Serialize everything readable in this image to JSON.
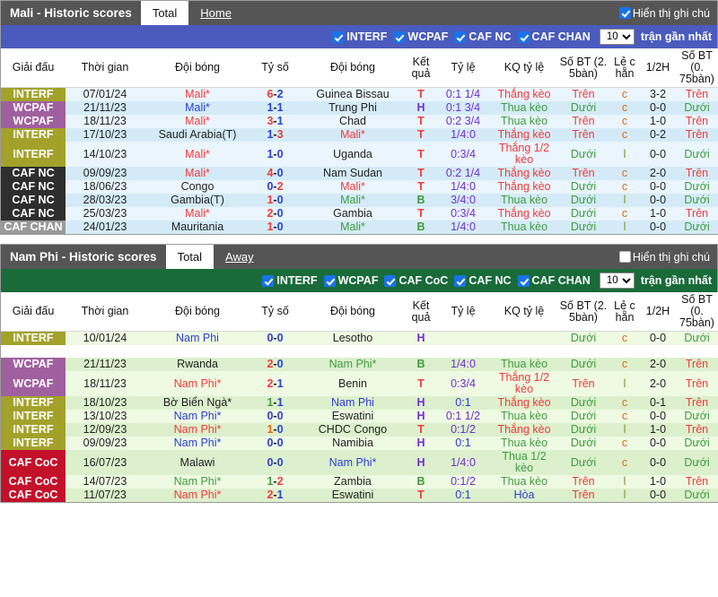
{
  "panels": [
    {
      "title": "Mali - Historic scores",
      "tabs": [
        {
          "label": "Total",
          "active": true
        },
        {
          "label": "Home",
          "active": false
        }
      ],
      "note_toggle": {
        "label": "Hiển thị ghi chú",
        "checked": true
      },
      "filter": {
        "options": [
          {
            "label": "INTERF",
            "checked": true
          },
          {
            "label": "WCPAF",
            "checked": true
          },
          {
            "label": "CAF NC",
            "checked": true
          },
          {
            "label": "CAF CHAN",
            "checked": true
          }
        ],
        "count_value": "10",
        "count_options": [
          "10",
          "20",
          "30",
          "50"
        ],
        "count_label": "trận gần nhất",
        "bar_color": "#4a5bbd"
      },
      "columns": [
        "Giải đấu",
        "Thời gian",
        "Đội bóng",
        "Tỷ số",
        "Đội bóng",
        "Kết quả",
        "Tỷ lệ",
        "KQ tỷ lệ",
        "Số BT (2. 5bàn)",
        "Lẻ c hẵn",
        "1/2H",
        "Số BT (0. 75bàn)"
      ],
      "league_colors": {
        "INTERF": "#a2a22a",
        "WCPAF": "#a0609f",
        "CAF NC": "#2e2e2e",
        "CAF CHAN": "#9a9a9a",
        "CAF CoC": "#c4112a"
      },
      "rows": [
        {
          "league": "INTERF",
          "date": "07/01/24",
          "home": "Mali*",
          "home_color": "c-red",
          "score": "6-2",
          "score_a_color": "c-red",
          "score_b_color": "c-blue",
          "away": "Guinea Bissau",
          "away_color": "c-dark",
          "result": "T",
          "result_color": "c-red",
          "odds": "0:1 1/4",
          "odds_color": "c-purple",
          "odds_result": "Thắng kèo",
          "odds_result_color": "c-red",
          "ou25": "Trên",
          "ou25_color": "c-red",
          "oddeven": "c",
          "oddeven_color": "c-orange",
          "ht": "3-2",
          "ht_color": "c-dark",
          "ou075": "Trên",
          "ou075_color": "c-red"
        },
        {
          "league": "WCPAF",
          "date": "21/11/23",
          "home": "Mali*",
          "home_color": "c-blue",
          "score": "1-1",
          "score_a_color": "c-blue",
          "score_b_color": "c-blue",
          "away": "Trung Phi",
          "away_color": "c-dark",
          "result": "H",
          "result_color": "c-purple",
          "odds": "0:1 3/4",
          "odds_color": "c-purple",
          "odds_result": "Thua kèo",
          "odds_result_color": "c-green",
          "ou25": "Dưới",
          "ou25_color": "c-green",
          "oddeven": "c",
          "oddeven_color": "c-orange",
          "ht": "0-0",
          "ht_color": "c-dark",
          "ou075": "Dưới",
          "ou075_color": "c-green"
        },
        {
          "league": "WCPAF",
          "date": "18/11/23",
          "home": "Mali*",
          "home_color": "c-red",
          "score": "3-1",
          "score_a_color": "c-red",
          "score_b_color": "c-blue",
          "away": "Chad",
          "away_color": "c-dark",
          "result": "T",
          "result_color": "c-red",
          "odds": "0:2 3/4",
          "odds_color": "c-purple",
          "odds_result": "Thua kèo",
          "odds_result_color": "c-green",
          "ou25": "Trên",
          "ou25_color": "c-red",
          "oddeven": "c",
          "oddeven_color": "c-orange",
          "ht": "1-0",
          "ht_color": "c-dark",
          "ou075": "Trên",
          "ou075_color": "c-red"
        },
        {
          "league": "INTERF",
          "date": "17/10/23",
          "home": "Saudi Arabia(T)",
          "home_color": "c-dark",
          "score": "1-3",
          "score_a_color": "c-blue",
          "score_b_color": "c-red",
          "away": "Mali*",
          "away_color": "c-red",
          "result": "T",
          "result_color": "c-red",
          "odds": "1/4:0",
          "odds_color": "c-purple",
          "odds_result": "Thắng kèo",
          "odds_result_color": "c-red",
          "ou25": "Trên",
          "ou25_color": "c-red",
          "oddeven": "c",
          "oddeven_color": "c-orange",
          "ht": "0-2",
          "ht_color": "c-dark",
          "ou075": "Trên",
          "ou075_color": "c-red"
        },
        {
          "league": "INTERF",
          "date": "14/10/23",
          "home": "Mali*",
          "home_color": "c-red",
          "score": "1-0",
          "score_a_color": "c-blue",
          "score_b_color": "c-blue",
          "away": "Uganda",
          "away_color": "c-dark",
          "result": "T",
          "result_color": "c-red",
          "odds": "0:3/4",
          "odds_color": "c-purple",
          "odds_result": "Thắng 1/2 kèo",
          "odds_result_color": "c-red",
          "ou25": "Dưới",
          "ou25_color": "c-green",
          "oddeven": "l",
          "oddeven_color": "c-olive",
          "ht": "0-0",
          "ht_color": "c-dark",
          "ou075": "Dưới",
          "ou075_color": "c-green"
        },
        {
          "league": "CAF NC",
          "date": "09/09/23",
          "home": "Mali*",
          "home_color": "c-red",
          "score": "4-0",
          "score_a_color": "c-red",
          "score_b_color": "c-blue",
          "away": "Nam Sudan",
          "away_color": "c-dark",
          "result": "T",
          "result_color": "c-red",
          "odds": "0:2 1/4",
          "odds_color": "c-purple",
          "odds_result": "Thắng kèo",
          "odds_result_color": "c-red",
          "ou25": "Trên",
          "ou25_color": "c-red",
          "oddeven": "c",
          "oddeven_color": "c-orange",
          "ht": "2-0",
          "ht_color": "c-dark",
          "ou075": "Trên",
          "ou075_color": "c-red"
        },
        {
          "league": "CAF NC",
          "date": "18/06/23",
          "home": "Congo",
          "home_color": "c-dark",
          "score": "0-2",
          "score_a_color": "c-blue",
          "score_b_color": "c-red",
          "away": "Mali*",
          "away_color": "c-red",
          "result": "T",
          "result_color": "c-red",
          "odds": "1/4:0",
          "odds_color": "c-purple",
          "odds_result": "Thắng kèo",
          "odds_result_color": "c-red",
          "ou25": "Dưới",
          "ou25_color": "c-green",
          "oddeven": "c",
          "oddeven_color": "c-orange",
          "ht": "0-0",
          "ht_color": "c-dark",
          "ou075": "Dưới",
          "ou075_color": "c-green"
        },
        {
          "league": "CAF NC",
          "date": "28/03/23",
          "home": "Gambia(T)",
          "home_color": "c-dark",
          "score": "1-0",
          "score_a_color": "c-red",
          "score_b_color": "c-blue",
          "away": "Mali*",
          "away_color": "c-green",
          "result": "B",
          "result_color": "c-green",
          "odds": "3/4:0",
          "odds_color": "c-purple",
          "odds_result": "Thua kèo",
          "odds_result_color": "c-green",
          "ou25": "Dưới",
          "ou25_color": "c-green",
          "oddeven": "l",
          "oddeven_color": "c-olive",
          "ht": "0-0",
          "ht_color": "c-dark",
          "ou075": "Dưới",
          "ou075_color": "c-green"
        },
        {
          "league": "CAF NC",
          "date": "25/03/23",
          "home": "Mali*",
          "home_color": "c-red",
          "score": "2-0",
          "score_a_color": "c-red",
          "score_b_color": "c-blue",
          "away": "Gambia",
          "away_color": "c-dark",
          "result": "T",
          "result_color": "c-red",
          "odds": "0:3/4",
          "odds_color": "c-purple",
          "odds_result": "Thắng kèo",
          "odds_result_color": "c-red",
          "ou25": "Dưới",
          "ou25_color": "c-green",
          "oddeven": "c",
          "oddeven_color": "c-orange",
          "ht": "1-0",
          "ht_color": "c-dark",
          "ou075": "Trên",
          "ou075_color": "c-red"
        },
        {
          "league": "CAF CHAN",
          "date": "24/01/23",
          "home": "Mauritania",
          "home_color": "c-dark",
          "score": "1-0",
          "score_a_color": "c-red",
          "score_b_color": "c-blue",
          "away": "Mali*",
          "away_color": "c-green",
          "result": "B",
          "result_color": "c-green",
          "odds": "1/4:0",
          "odds_color": "c-purple",
          "odds_result": "Thua kèo",
          "odds_result_color": "c-green",
          "ou25": "Dưới",
          "ou25_color": "c-green",
          "oddeven": "l",
          "oddeven_color": "c-olive",
          "ht": "0-0",
          "ht_color": "c-dark",
          "ou075": "Dưới",
          "ou075_color": "c-green"
        }
      ]
    },
    {
      "title": "Nam Phi - Historic scores",
      "tabs": [
        {
          "label": "Total",
          "active": true
        },
        {
          "label": "Away",
          "active": false
        }
      ],
      "note_toggle": {
        "label": "Hiển thị ghi chú",
        "checked": false
      },
      "filter": {
        "options": [
          {
            "label": "INTERF",
            "checked": true
          },
          {
            "label": "WCPAF",
            "checked": true
          },
          {
            "label": "CAF CoC",
            "checked": true
          },
          {
            "label": "CAF NC",
            "checked": true
          },
          {
            "label": "CAF CHAN",
            "checked": true
          }
        ],
        "count_value": "10",
        "count_options": [
          "10",
          "20",
          "30",
          "50"
        ],
        "count_label": "trận gần nhất",
        "bar_color": "#196b3a"
      },
      "columns": [
        "Giải đấu",
        "Thời gian",
        "Đội bóng",
        "Tỷ số",
        "Đội bóng",
        "Kết quả",
        "Tỷ lệ",
        "KQ tỷ lệ",
        "Số BT (2. 5bàn)",
        "Lẻ c hẵn",
        "1/2H",
        "Số BT (0. 75bàn)"
      ],
      "league_colors": {
        "INTERF": "#a2a22a",
        "WCPAF": "#a0609f",
        "CAF NC": "#2e2e2e",
        "CAF CHAN": "#9a9a9a",
        "CAF CoC": "#c4112a"
      },
      "rows": [
        {
          "league": "INTERF",
          "date": "10/01/24",
          "home": "Nam Phi",
          "home_color": "c-blue",
          "score": "0-0",
          "score_a_color": "c-blue",
          "score_b_color": "c-blue",
          "away": "Lesotho",
          "away_color": "c-dark",
          "result": "H",
          "result_color": "c-purple",
          "odds": "",
          "odds_color": "c-purple",
          "odds_result": "",
          "odds_result_color": "c-red",
          "ou25": "Dưới",
          "ou25_color": "c-green",
          "oddeven": "c",
          "oddeven_color": "c-orange",
          "ht": "0-0",
          "ht_color": "c-dark",
          "ou075": "Dưới",
          "ou075_color": "c-green"
        },
        {
          "blank": true
        },
        {
          "league": "WCPAF",
          "date": "21/11/23",
          "home": "Rwanda",
          "home_color": "c-dark",
          "score": "2-0",
          "score_a_color": "c-red",
          "score_b_color": "c-blue",
          "away": "Nam Phi*",
          "away_color": "c-green",
          "result": "B",
          "result_color": "c-green",
          "odds": "1/4:0",
          "odds_color": "c-purple",
          "odds_result": "Thua kèo",
          "odds_result_color": "c-green",
          "ou25": "Dưới",
          "ou25_color": "c-green",
          "oddeven": "c",
          "oddeven_color": "c-orange",
          "ht": "2-0",
          "ht_color": "c-dark",
          "ou075": "Trên",
          "ou075_color": "c-red"
        },
        {
          "league": "WCPAF",
          "date": "18/11/23",
          "home": "Nam Phi*",
          "home_color": "c-red",
          "score": "2-1",
          "score_a_color": "c-red",
          "score_b_color": "c-blue",
          "away": "Benin",
          "away_color": "c-dark",
          "result": "T",
          "result_color": "c-red",
          "odds": "0:3/4",
          "odds_color": "c-purple",
          "odds_result": "Thắng 1/2 kèo",
          "odds_result_color": "c-red",
          "ou25": "Trên",
          "ou25_color": "c-red",
          "oddeven": "l",
          "oddeven_color": "c-olive",
          "ht": "2-0",
          "ht_color": "c-dark",
          "ou075": "Trên",
          "ou075_color": "c-red"
        },
        {
          "league": "INTERF",
          "date": "18/10/23",
          "home": "Bờ Biển Ngà*",
          "home_color": "c-dark",
          "score": "1-1",
          "score_a_color": "c-green",
          "score_b_color": "c-blue",
          "away": "Nam Phi",
          "away_color": "c-blue",
          "result": "H",
          "result_color": "c-purple",
          "odds": "0:1",
          "odds_color": "c-blue",
          "odds_result": "Thắng kèo",
          "odds_result_color": "c-red",
          "ou25": "Dưới",
          "ou25_color": "c-green",
          "oddeven": "c",
          "oddeven_color": "c-orange",
          "ht": "0-1",
          "ht_color": "c-dark",
          "ou075": "Trên",
          "ou075_color": "c-red"
        },
        {
          "league": "INTERF",
          "date": "13/10/23",
          "home": "Nam Phi*",
          "home_color": "c-blue",
          "score": "0-0",
          "score_a_color": "c-blue",
          "score_b_color": "c-blue",
          "away": "Eswatini",
          "away_color": "c-dark",
          "result": "H",
          "result_color": "c-purple",
          "odds": "0:1 1/2",
          "odds_color": "c-purple",
          "odds_result": "Thua kèo",
          "odds_result_color": "c-green",
          "ou25": "Dưới",
          "ou25_color": "c-green",
          "oddeven": "c",
          "oddeven_color": "c-orange",
          "ht": "0-0",
          "ht_color": "c-dark",
          "ou075": "Dưới",
          "ou075_color": "c-green"
        },
        {
          "league": "INTERF",
          "date": "12/09/23",
          "home": "Nam Phi*",
          "home_color": "c-red",
          "score": "1-0",
          "score_a_color": "c-orange",
          "score_b_color": "c-blue",
          "away": "CHDC Congo",
          "away_color": "c-dark",
          "result": "T",
          "result_color": "c-red",
          "odds": "0:1/2",
          "odds_color": "c-purple",
          "odds_result": "Thắng kèo",
          "odds_result_color": "c-red",
          "ou25": "Dưới",
          "ou25_color": "c-green",
          "oddeven": "l",
          "oddeven_color": "c-olive",
          "ht": "1-0",
          "ht_color": "c-dark",
          "ou075": "Trên",
          "ou075_color": "c-red"
        },
        {
          "league": "INTERF",
          "date": "09/09/23",
          "home": "Nam Phi*",
          "home_color": "c-blue",
          "score": "0-0",
          "score_a_color": "c-blue",
          "score_b_color": "c-blue",
          "away": "Namibia",
          "away_color": "c-dark",
          "result": "H",
          "result_color": "c-purple",
          "odds": "0:1",
          "odds_color": "c-blue",
          "odds_result": "Thua kèo",
          "odds_result_color": "c-green",
          "ou25": "Dưới",
          "ou25_color": "c-green",
          "oddeven": "c",
          "oddeven_color": "c-orange",
          "ht": "0-0",
          "ht_color": "c-dark",
          "ou075": "Dưới",
          "ou075_color": "c-green"
        },
        {
          "league": "CAF CoC",
          "date": "16/07/23",
          "home": "Malawi",
          "home_color": "c-dark",
          "score": "0-0",
          "score_a_color": "c-blue",
          "score_b_color": "c-blue",
          "away": "Nam Phi*",
          "away_color": "c-blue",
          "result": "H",
          "result_color": "c-purple",
          "odds": "1/4:0",
          "odds_color": "c-purple",
          "odds_result": "Thua 1/2 kèo",
          "odds_result_color": "c-green",
          "ou25": "Dưới",
          "ou25_color": "c-green",
          "oddeven": "c",
          "oddeven_color": "c-orange",
          "ht": "0-0",
          "ht_color": "c-dark",
          "ou075": "Dưới",
          "ou075_color": "c-green"
        },
        {
          "league": "CAF CoC",
          "date": "14/07/23",
          "home": "Nam Phi*",
          "home_color": "c-green",
          "score": "1-2",
          "score_a_color": "c-green",
          "score_b_color": "c-red",
          "away": "Zambia",
          "away_color": "c-dark",
          "result": "B",
          "result_color": "c-green",
          "odds": "0:1/2",
          "odds_color": "c-purple",
          "odds_result": "Thua kèo",
          "odds_result_color": "c-green",
          "ou25": "Trên",
          "ou25_color": "c-red",
          "oddeven": "l",
          "oddeven_color": "c-olive",
          "ht": "1-0",
          "ht_color": "c-dark",
          "ou075": "Trên",
          "ou075_color": "c-red"
        },
        {
          "league": "CAF CoC",
          "date": "11/07/23",
          "home": "Nam Phi*",
          "home_color": "c-red",
          "score": "2-1",
          "score_a_color": "c-red",
          "score_b_color": "c-blue",
          "away": "Eswatini",
          "away_color": "c-dark",
          "result": "T",
          "result_color": "c-red",
          "odds": "0:1",
          "odds_color": "c-blue",
          "odds_result": "Hòa",
          "odds_result_color": "c-blue",
          "ou25": "Trên",
          "ou25_color": "c-red",
          "oddeven": "l",
          "oddeven_color": "c-olive",
          "ht": "0-0",
          "ht_color": "c-dark",
          "ou075": "Dưới",
          "ou075_color": "c-green"
        }
      ]
    }
  ]
}
